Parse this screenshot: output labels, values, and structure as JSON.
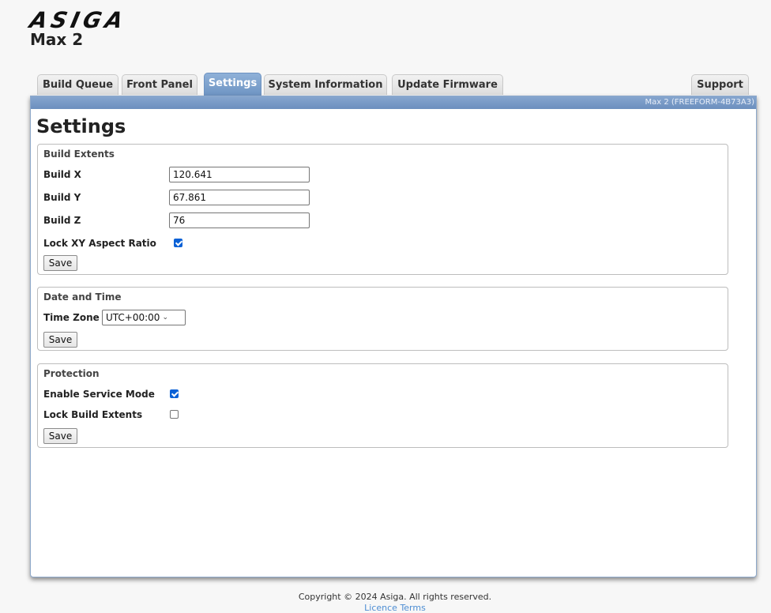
{
  "header": {
    "logo_text": "ASIGA",
    "model": "Max 2"
  },
  "tabs": [
    {
      "label": "Build Queue",
      "active": false
    },
    {
      "label": "Front Panel",
      "active": false
    },
    {
      "label": "Settings",
      "active": true
    },
    {
      "label": "System Information",
      "active": false
    },
    {
      "label": "Update Firmware",
      "active": false
    },
    {
      "label": "Support",
      "active": false
    }
  ],
  "device_id": "Max 2 (FREEFORM-4B73A3)",
  "page_title": "Settings",
  "build_extents": {
    "title": "Build Extents",
    "build_x_label": "Build X",
    "build_x_value": "120.641",
    "build_y_label": "Build Y",
    "build_y_value": "67.861",
    "build_z_label": "Build Z",
    "build_z_value": "76",
    "lock_aspect_label": "Lock XY Aspect Ratio",
    "lock_aspect_checked": true,
    "save_label": "Save"
  },
  "date_time": {
    "title": "Date and Time",
    "timezone_label": "Time Zone",
    "timezone_value": "UTC+00:00",
    "save_label": "Save"
  },
  "protection": {
    "title": "Protection",
    "service_mode_label": "Enable Service Mode",
    "service_mode_checked": true,
    "lock_extents_label": "Lock Build Extents",
    "lock_extents_checked": false,
    "save_label": "Save"
  },
  "footer": {
    "copyright": "Copyright © 2024 Asiga. All rights reserved.",
    "license_link": "Licence Terms"
  },
  "colors": {
    "accent": "#6d93c2",
    "checkbox": "#0a61d6",
    "link": "#4d8dd3"
  }
}
